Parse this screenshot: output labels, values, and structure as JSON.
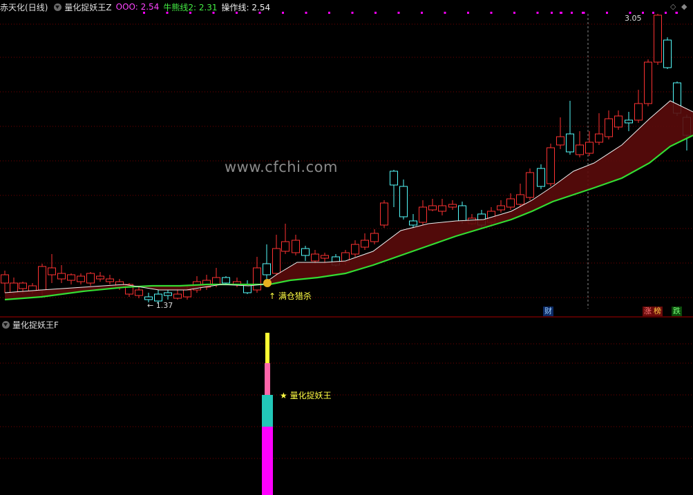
{
  "main": {
    "stock_name": "赤天化",
    "period": "(日线)",
    "indicator_name": "量化捉妖王Z",
    "o00_label": "OOO: 2.54",
    "bull_label": "牛熊线2: 2.31",
    "op_label": "操作线: 2.54",
    "high_label": "3.05",
    "low_label": "1.37",
    "signal_label": "满仓猎杀",
    "watermark": "www.cfchi.com",
    "tags": {
      "cai": "财",
      "zhang": "涨",
      "bang": "榜",
      "die": "跌"
    },
    "control_icons": [
      "◇",
      "◆"
    ]
  },
  "sub": {
    "indicator_name": "量化捉妖王F",
    "star_label": "量化捉妖王"
  },
  "colors": {
    "up": "#ff3232",
    "down": "#54fcfc",
    "bull_line": "#33dd33",
    "op_line": "#f0f0f0",
    "fill": "#5a0b0b",
    "grid": "#7a0000",
    "magenta": "#ff00ff",
    "yellow": "#ffff33"
  },
  "chart_data": {
    "type": "candlestick",
    "price_range": [
      1.37,
      3.05
    ],
    "series": [
      {
        "name": "OOO",
        "last": 2.54
      },
      {
        "name": "牛熊线2",
        "last": 2.31
      },
      {
        "name": "操作线",
        "last": 2.54
      }
    ]
  }
}
